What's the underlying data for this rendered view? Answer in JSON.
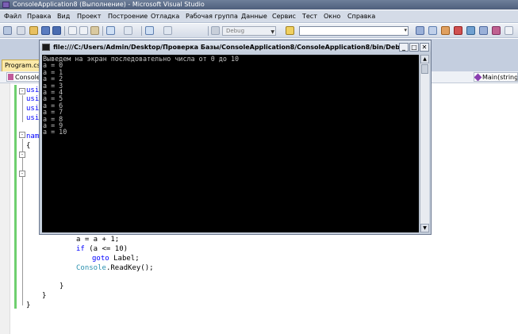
{
  "window": {
    "title": "ConsoleApplication8 (Выполнение) - Microsoft Visual Studio"
  },
  "menu": [
    "Файл",
    "Правка",
    "Вид",
    "Проект",
    "Построение",
    "Отладка",
    "Рабочая группа",
    "Данные",
    "Сервис",
    "Тест",
    "Окно",
    "Справка"
  ],
  "toolbar": {
    "config": "Debug",
    "find_value": ""
  },
  "tabs": {
    "active": "Program.cs"
  },
  "nav": {
    "left": "Console",
    "right": "Main(string["
  },
  "code": {
    "using_lines": [
      "usi",
      "usi",
      "usi",
      "usi"
    ],
    "namespace_kw": "nam",
    "lines": [
      "{",
      "a = a + 1;",
      "if (a <= 10)",
      "goto Label;",
      "Console.ReadKey();",
      "}",
      "}",
      "}"
    ]
  },
  "console": {
    "title": "file:///C:/Users/Admin/Desktop/Проверка Базы/ConsoleApplication8/ConsoleApplication8/bin/Debu...",
    "output": "Выведем на экран последовательно числа от 0 до 10\na = 0\na = 1\na = 2\na = 3\na = 4\na = 5\na = 6\na = 7\na = 8\na = 9\na = 10"
  }
}
